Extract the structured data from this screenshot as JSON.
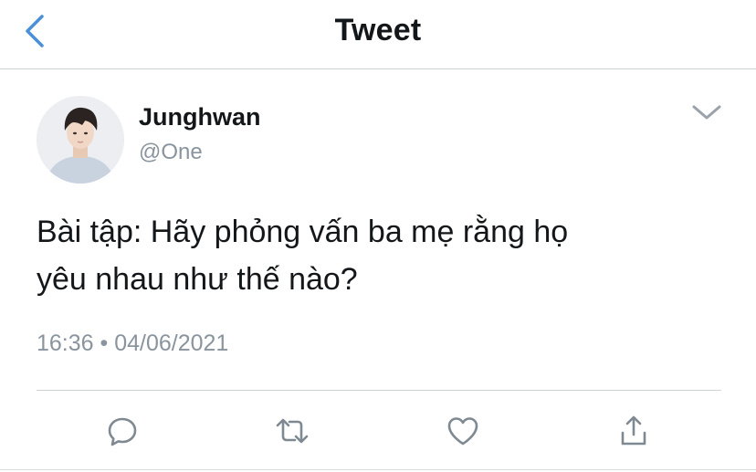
{
  "header": {
    "title": "Tweet",
    "back_icon": "chevron-left-icon"
  },
  "tweet": {
    "author": {
      "display_name": "Junghwan",
      "handle": "@One"
    },
    "text_lines": [
      "Bài tập: Hãy phỏng vấn ba mẹ rằng họ",
      "yêu nhau như thế nào?"
    ],
    "timestamp": "16:36 • 04/06/2021",
    "menu_icon": "chevron-down-icon"
  },
  "actions": [
    {
      "name": "reply",
      "icon": "reply-icon"
    },
    {
      "name": "retweet",
      "icon": "retweet-icon"
    },
    {
      "name": "like",
      "icon": "heart-icon"
    },
    {
      "name": "share",
      "icon": "share-icon"
    }
  ],
  "colors": {
    "accent": "#4a90d9",
    "text_primary": "#14171a",
    "text_secondary": "#8a949e",
    "icon": "#7f8992",
    "divider": "#cfd4d9"
  }
}
